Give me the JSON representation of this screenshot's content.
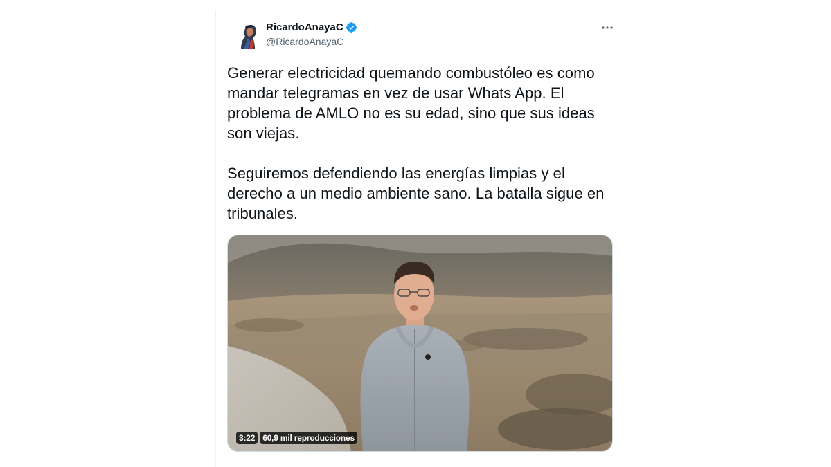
{
  "tweet": {
    "author": {
      "name": "RicardoAnayaC",
      "handle": "@RicardoAnayaC",
      "verified": true,
      "avatar_icon": "profile-photo-icon"
    },
    "more_icon": "more-horizontal-icon",
    "text_paragraphs": [
      "Generar electricidad quemando combustóleo es como\nmandar telegramas en vez de usar Whats App. El\nproblema de AMLO no es su edad, sino que sus ideas\nson viejas.",
      "Seguiremos defendiendo las energías limpias y el\nderecho a un medio ambiente sano. La batalla sigue en\ntribunales."
    ],
    "video": {
      "duration": "3:22",
      "views": "60,9 mil reproducciones"
    }
  },
  "colors": {
    "text_primary": "#0f1419",
    "text_secondary": "#536471",
    "verified_blue": "#1d9bf0",
    "border": "#cfd9de"
  }
}
